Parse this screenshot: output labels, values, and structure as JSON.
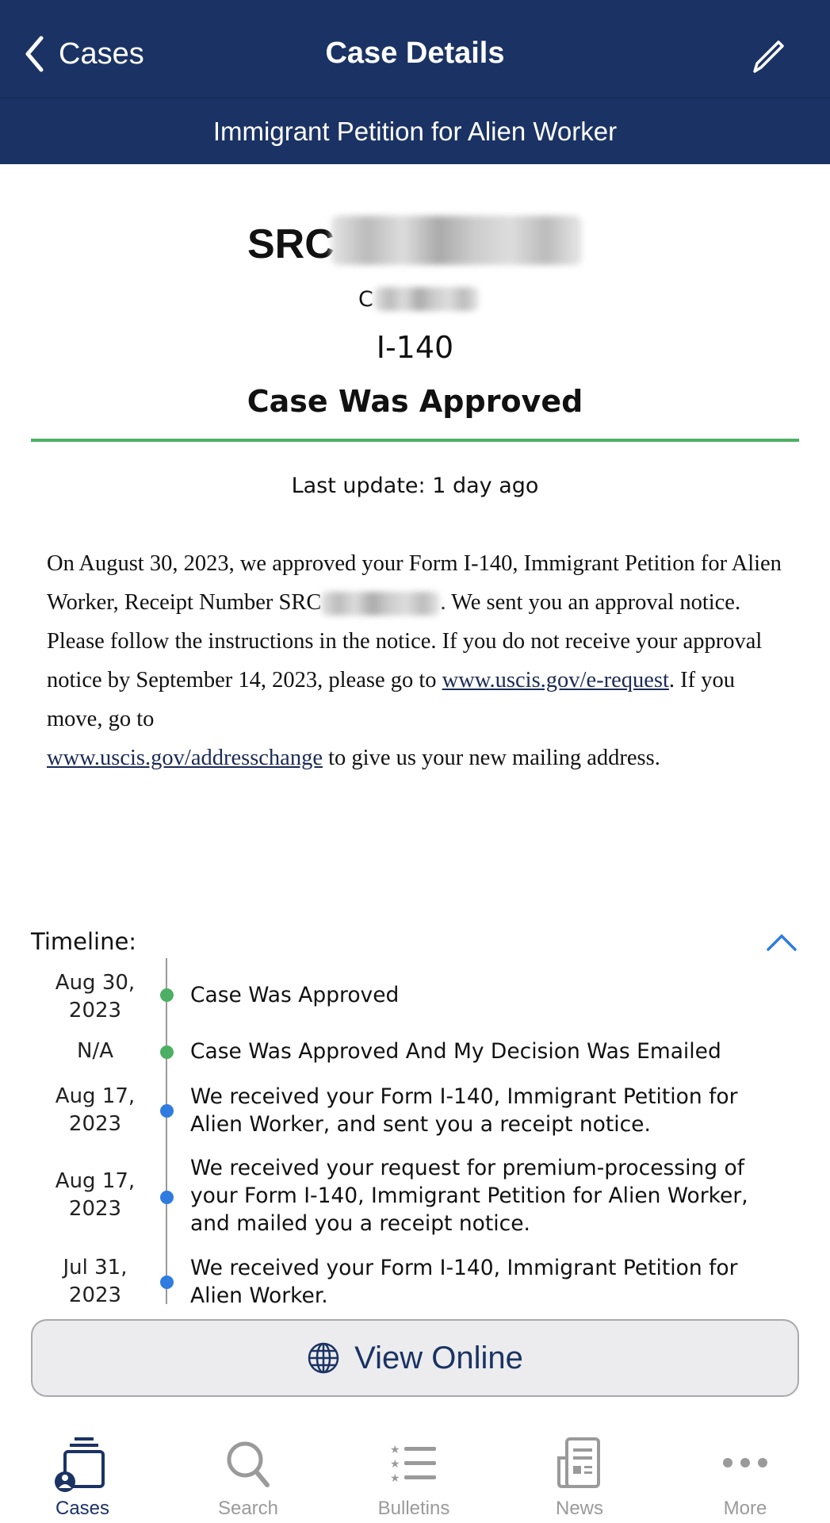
{
  "nav": {
    "back_label": "Cases",
    "title": "Case Details",
    "edit_icon": "pencil-icon"
  },
  "subtitle": "Immigrant Petition for Alien Worker",
  "case": {
    "receipt_prefix": "SRC",
    "line2_prefix": "C",
    "form": "I-140",
    "status": "Case Was Approved",
    "status_color": "#4caf64",
    "last_update": "Last update: 1 day ago"
  },
  "description": {
    "part1": "On August 30, 2023, we approved your Form I-140, Immigrant Petition for Alien Worker, Receipt Number SRC",
    "part2": ". We sent you an approval notice. Please follow the instructions in the notice. If you do not receive your approval notice by September 14, 2023, please go to ",
    "link1": "www.uscis.gov/e-request",
    "part3": ". If you move, go to ",
    "link2": "www.uscis.gov/addresschange",
    "part4": " to give us your new mailing address."
  },
  "timeline": {
    "label": "Timeline:",
    "items": [
      {
        "date": "Aug 30, 2023",
        "text": "Case Was Approved",
        "color": "#4caf64"
      },
      {
        "date": "N/A",
        "text": "Case Was Approved And My Decision Was Emailed",
        "color": "#4caf64"
      },
      {
        "date": "Aug 17, 2023",
        "text": "We received your Form I-140, Immigrant Petition for Alien Worker, and sent you a receipt notice.",
        "color": "#2f7be0"
      },
      {
        "date": "Aug 17, 2023",
        "text": "We received your request for premium-processing of your Form I-140, Immigrant Petition for Alien Worker, and mailed you a receipt notice.",
        "color": "#2f7be0"
      },
      {
        "date": "Jul 31, 2023",
        "text": "We received your Form I-140, Immigrant Petition for Alien Worker.",
        "color": "#2f7be0"
      }
    ]
  },
  "view_online": "View Online",
  "tabs": [
    {
      "label": "Cases",
      "active": true
    },
    {
      "label": "Search"
    },
    {
      "label": "Bulletins"
    },
    {
      "label": "News"
    },
    {
      "label": "More"
    }
  ]
}
